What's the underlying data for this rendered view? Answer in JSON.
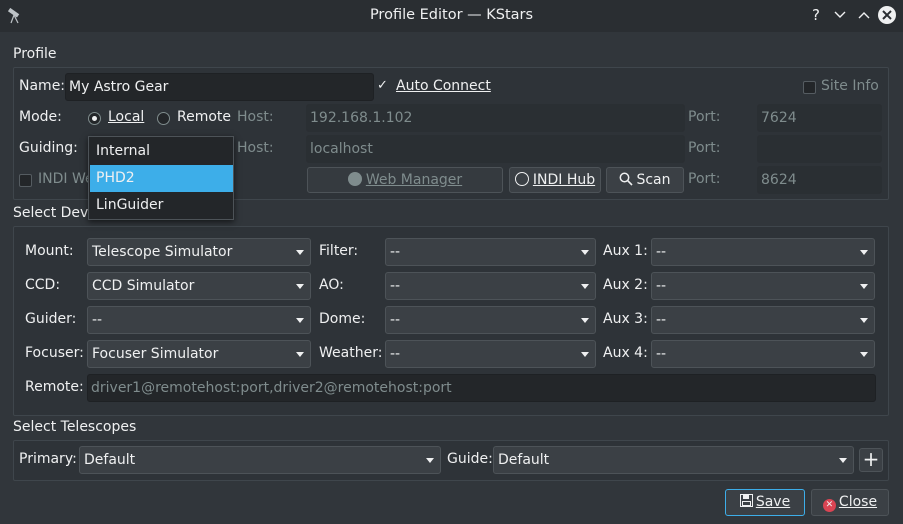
{
  "window": {
    "title": "Profile Editor — KStars",
    "help": "?",
    "minimize": "⌄",
    "maximize": "⌃",
    "close": "✕"
  },
  "profile": {
    "section": "Profile",
    "name_label": "Name:",
    "name_value": "My Astro Gear",
    "auto_connect": {
      "label": "Auto Connect",
      "checked": true
    },
    "site_info": {
      "label": "Site Info",
      "checked": false
    },
    "mode_label": "Mode:",
    "mode_local": "Local",
    "mode_remote": "Remote",
    "mode_selected": "Local",
    "host_label": "Host:",
    "host_value": "192.168.1.102",
    "port_label": "Port:",
    "port_value": "7624",
    "guiding_label": "Guiding:",
    "guiding_host_label": "Host:",
    "guiding_host_value": "localhost",
    "guiding_port_label": "Port:",
    "guiding_port_value": "",
    "indi_web_label": "INDI We",
    "web_manager": "Web Manager",
    "indi_hub": "INDI Hub",
    "scan": "Scan",
    "web_port_label": "Port:",
    "web_port_value": "8624"
  },
  "guiding_popup": {
    "options": [
      "Internal",
      "PHD2",
      "LinGuider"
    ],
    "selected": "PHD2"
  },
  "devices": {
    "section": "Select Devi",
    "mount_label": "Mount:",
    "mount_value": "Telescope Simulator",
    "ccd_label": "CCD:",
    "ccd_value": "CCD Simulator",
    "guider_label": "Guider:",
    "guider_value": "--",
    "focuser_label": "Focuser:",
    "focuser_value": "Focuser Simulator",
    "filter_label": "Filter:",
    "filter_value": "--",
    "ao_label": "AO:",
    "ao_value": "--",
    "dome_label": "Dome:",
    "dome_value": "--",
    "weather_label": "Weather:",
    "weather_value": "--",
    "aux1_label": "Aux 1:",
    "aux1_value": "--",
    "aux2_label": "Aux 2:",
    "aux2_value": "--",
    "aux3_label": "Aux 3:",
    "aux3_value": "--",
    "aux4_label": "Aux 4:",
    "aux4_value": "--",
    "remote_label": "Remote:",
    "remote_placeholder": "driver1@remotehost:port,driver2@remotehost:port"
  },
  "telescopes": {
    "section": "Select Telescopes",
    "primary_label": "Primary:",
    "primary_value": "Default",
    "guide_label": "Guide:",
    "guide_value": "Default",
    "add": "+"
  },
  "footer": {
    "save": "Save",
    "close": "Close"
  },
  "colors": {
    "accent": "#3daee9",
    "background": "#31363b",
    "close_icon": "#da4453"
  }
}
